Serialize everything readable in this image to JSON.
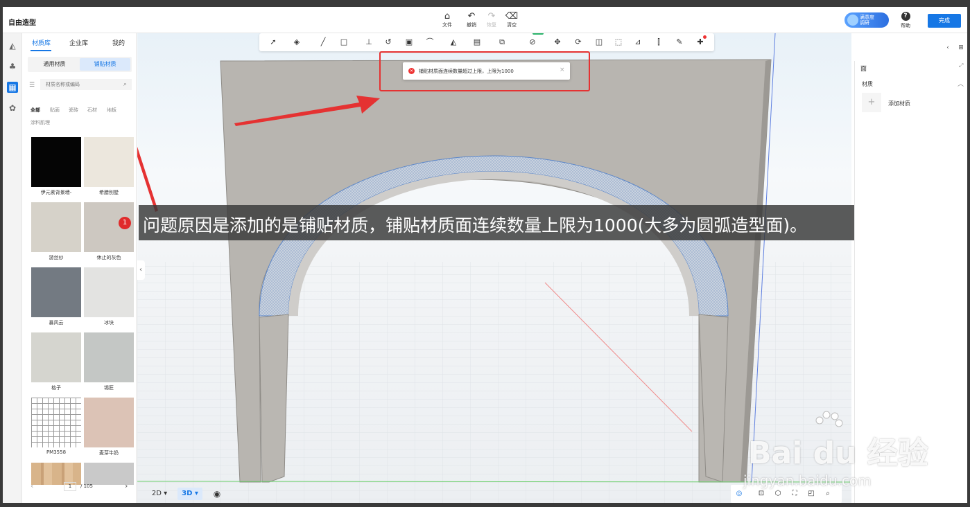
{
  "app": {
    "title": "自由造型"
  },
  "toolbar_top": {
    "file": "文件",
    "undo": "撤销",
    "redo": "恢复",
    "clear": "清空",
    "satisfaction_line1": "满意度",
    "satisfaction_line2": "调研",
    "help": "帮助",
    "done": "完成"
  },
  "material_panel": {
    "tabs": [
      "材质库",
      "企业库",
      "我的"
    ],
    "subtabs": [
      "通用材质",
      "铺贴材质"
    ],
    "search_placeholder": "材质名称或编码",
    "categories": [
      "全部",
      "贴面",
      "瓷砖",
      "石材",
      "地板",
      "涂料肌理"
    ],
    "tiles": [
      {
        "label": "伊元素背景墙-",
        "color": "#050505"
      },
      {
        "label": "希腊别墅",
        "color": "#ece7dd"
      },
      {
        "label": "游丝纱",
        "color": "#d6d2c9"
      },
      {
        "label": "休止的灰色",
        "color": "#cdc8c1"
      },
      {
        "label": "暴风云",
        "color": "#737a82"
      },
      {
        "label": "冰块",
        "color": "#e3e3e1"
      },
      {
        "label": "格子",
        "color": "#d5d5cf"
      },
      {
        "label": "锡匠",
        "color": "#c4c7c5"
      },
      {
        "label": "PM3558",
        "color": "#ffffff"
      },
      {
        "label": "麦芽牛奶",
        "color": "#dcc3b6"
      }
    ],
    "pager": {
      "current": "1",
      "total": "/ 105"
    }
  },
  "toast": {
    "message": "铺贴材质面连续数量超过上限，上限为1000"
  },
  "tool_badge": "限免",
  "caption": {
    "number": "1",
    "text": "问题原因是添加的是铺贴材质，铺贴材质面连续数量上限为1000(大多为圆弧造型面)。"
  },
  "view_controls": {
    "mode_2d": "2D",
    "mode_3d": "3D"
  },
  "right_panel": {
    "title": "面",
    "section": "材质",
    "add_material": "添加材质"
  },
  "watermark": {
    "main": "Bai du 经验",
    "url": "jingyan.baidu.com"
  },
  "colors": {
    "accent": "#1677e5",
    "alert": "#e53232",
    "wall": "#b8b5b0"
  }
}
